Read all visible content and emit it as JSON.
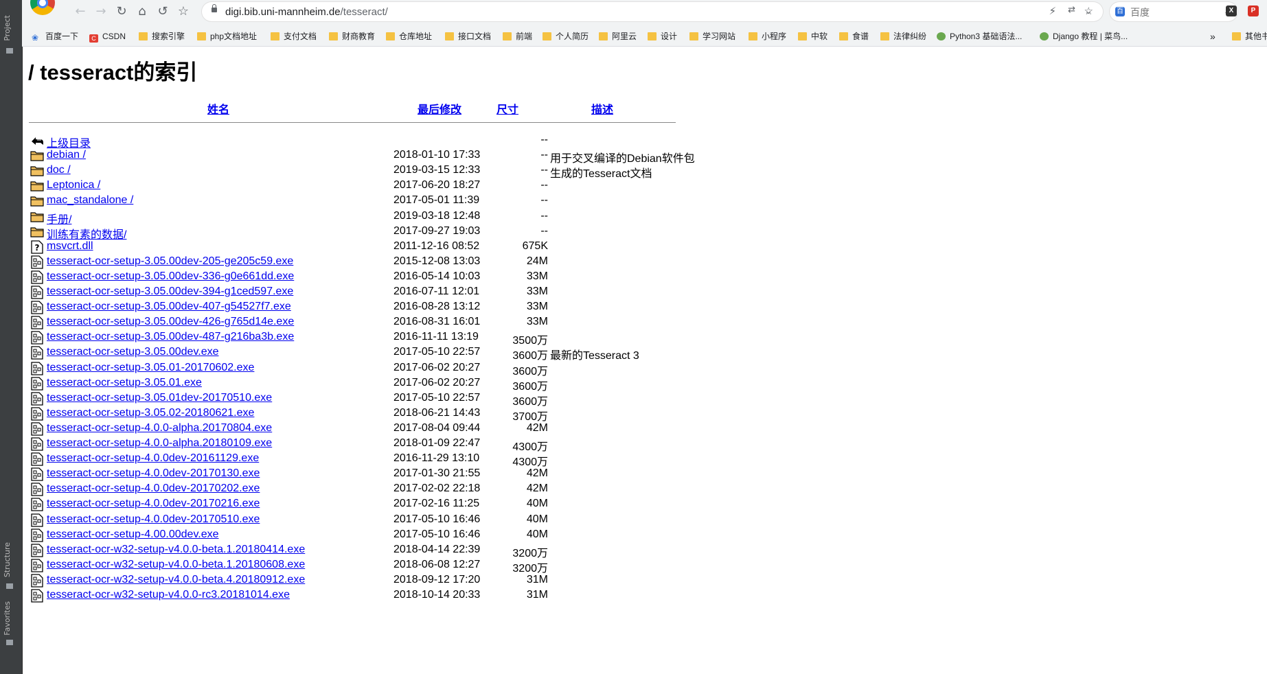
{
  "ide": {
    "tabs": [
      "Project",
      "Structure",
      "Favorites"
    ]
  },
  "browser": {
    "url_host": "digi.bib.uni-mannheim.de",
    "url_path": "/tesseract/",
    "search_placeholder": "百度",
    "bookmarks": [
      {
        "label": "百度一下",
        "icon": "paw-icon"
      },
      {
        "label": "CSDN",
        "icon": "csdn-icon"
      },
      {
        "label": "搜索引擎",
        "icon": "folder-icon"
      },
      {
        "label": "php文档地址",
        "icon": "folder-icon"
      },
      {
        "label": "支付文档",
        "icon": "folder-icon"
      },
      {
        "label": "财商教育",
        "icon": "folder-icon"
      },
      {
        "label": "仓库地址",
        "icon": "folder-icon"
      },
      {
        "label": "接口文档",
        "icon": "folder-icon"
      },
      {
        "label": "前端",
        "icon": "folder-icon"
      },
      {
        "label": "个人简历",
        "icon": "folder-icon"
      },
      {
        "label": "阿里云",
        "icon": "folder-icon"
      },
      {
        "label": "设计",
        "icon": "folder-icon"
      },
      {
        "label": "学习网站",
        "icon": "folder-icon"
      },
      {
        "label": "小程序",
        "icon": "folder-icon"
      },
      {
        "label": "中软",
        "icon": "folder-icon"
      },
      {
        "label": "食谱",
        "icon": "folder-icon"
      },
      {
        "label": "法律纠纷",
        "icon": "folder-icon"
      },
      {
        "label": "Python3 基础语法...",
        "icon": "runoob-icon"
      },
      {
        "label": "Django 教程 | 菜鸟...",
        "icon": "runoob-icon"
      }
    ],
    "more_bookmarks": "»",
    "other_bookmarks": "其他书"
  },
  "page": {
    "title": "/ tesseract的索引",
    "headers": {
      "name": "姓名",
      "modified": "最后修改",
      "size": "尺寸",
      "description": "描述"
    },
    "rows": [
      {
        "type": "back",
        "name": "上级目录",
        "date": "",
        "size": "--",
        "desc": ""
      },
      {
        "type": "folder",
        "name": "debian /",
        "date": "2018-01-10 17:33",
        "size": "--",
        "desc": "用于交叉编译的Debian软件包"
      },
      {
        "type": "folder",
        "name": "doc /",
        "date": "2019-03-15 12:33",
        "size": "--",
        "desc": "生成的Tesseract文档"
      },
      {
        "type": "folder",
        "name": "Leptonica /",
        "date": "2017-06-20 18:27",
        "size": "--",
        "desc": ""
      },
      {
        "type": "folder",
        "name": "mac_standalone /",
        "date": "2017-05-01 11:39",
        "size": "--",
        "desc": ""
      },
      {
        "type": "folder",
        "name": "手册/",
        "date": "2019-03-18 12:48",
        "size": "--",
        "desc": ""
      },
      {
        "type": "folder",
        "name": "训练有素的数据/",
        "date": "2017-09-27 19:03",
        "size": "--",
        "desc": ""
      },
      {
        "type": "unknown",
        "name": "msvcrt.dll",
        "date": "2011-12-16 08:52",
        "size": "675K",
        "desc": ""
      },
      {
        "type": "binary",
        "name": "tesseract-ocr-setup-3.05.00dev-205-ge205c59.exe",
        "date": "2015-12-08 13:03",
        "size": "24M",
        "desc": ""
      },
      {
        "type": "binary",
        "name": "tesseract-ocr-setup-3.05.00dev-336-g0e661dd.exe",
        "date": "2016-05-14 10:03",
        "size": "33M",
        "desc": ""
      },
      {
        "type": "binary",
        "name": "tesseract-ocr-setup-3.05.00dev-394-g1ced597.exe",
        "date": "2016-07-11 12:01",
        "size": "33M",
        "desc": ""
      },
      {
        "type": "binary",
        "name": "tesseract-ocr-setup-3.05.00dev-407-g54527f7.exe",
        "date": "2016-08-28 13:12",
        "size": "33M",
        "desc": ""
      },
      {
        "type": "binary",
        "name": "tesseract-ocr-setup-3.05.00dev-426-g765d14e.exe",
        "date": "2016-08-31 16:01",
        "size": "33M",
        "desc": ""
      },
      {
        "type": "binary",
        "name": "tesseract-ocr-setup-3.05.00dev-487-g216ba3b.exe",
        "date": "2016-11-11 13:19",
        "size": "3500万",
        "desc": ""
      },
      {
        "type": "binary",
        "name": "tesseract-ocr-setup-3.05.00dev.exe",
        "date": "2017-05-10 22:57",
        "size": "3600万",
        "desc": "最新的Tesseract 3"
      },
      {
        "type": "binary",
        "name": "tesseract-ocr-setup-3.05.01-20170602.exe",
        "date": "2017-06-02 20:27",
        "size": "3600万",
        "desc": ""
      },
      {
        "type": "binary",
        "name": "tesseract-ocr-setup-3.05.01.exe",
        "date": "2017-06-02 20:27",
        "size": "3600万",
        "desc": ""
      },
      {
        "type": "binary",
        "name": "tesseract-ocr-setup-3.05.01dev-20170510.exe",
        "date": "2017-05-10 22:57",
        "size": "3600万",
        "desc": ""
      },
      {
        "type": "binary",
        "name": "tesseract-ocr-setup-3.05.02-20180621.exe",
        "date": "2018-06-21 14:43",
        "size": "3700万",
        "desc": ""
      },
      {
        "type": "binary",
        "name": "tesseract-ocr-setup-4.0.0-alpha.20170804.exe",
        "date": "2017-08-04 09:44",
        "size": "42M",
        "desc": ""
      },
      {
        "type": "binary",
        "name": "tesseract-ocr-setup-4.0.0-alpha.20180109.exe",
        "date": "2018-01-09 22:47",
        "size": "4300万",
        "desc": ""
      },
      {
        "type": "binary",
        "name": "tesseract-ocr-setup-4.0.0dev-20161129.exe",
        "date": "2016-11-29 13:10",
        "size": "4300万",
        "desc": ""
      },
      {
        "type": "binary",
        "name": "tesseract-ocr-setup-4.0.0dev-20170130.exe",
        "date": "2017-01-30 21:55",
        "size": "42M",
        "desc": ""
      },
      {
        "type": "binary",
        "name": "tesseract-ocr-setup-4.0.0dev-20170202.exe",
        "date": "2017-02-02 22:18",
        "size": "42M",
        "desc": ""
      },
      {
        "type": "binary",
        "name": "tesseract-ocr-setup-4.0.0dev-20170216.exe",
        "date": "2017-02-16 11:25",
        "size": "40M",
        "desc": ""
      },
      {
        "type": "binary",
        "name": "tesseract-ocr-setup-4.0.0dev-20170510.exe",
        "date": "2017-05-10 16:46",
        "size": "40M",
        "desc": ""
      },
      {
        "type": "binary",
        "name": "tesseract-ocr-setup-4.00.00dev.exe",
        "date": "2017-05-10 16:46",
        "size": "40M",
        "desc": ""
      },
      {
        "type": "binary",
        "name": "tesseract-ocr-w32-setup-v4.0.0-beta.1.20180414.exe",
        "date": "2018-04-14 22:39",
        "size": "3200万",
        "desc": ""
      },
      {
        "type": "binary",
        "name": "tesseract-ocr-w32-setup-v4.0.0-beta.1.20180608.exe",
        "date": "2018-06-08 12:27",
        "size": "3200万",
        "desc": ""
      },
      {
        "type": "binary",
        "name": "tesseract-ocr-w32-setup-v4.0.0-beta.4.20180912.exe",
        "date": "2018-09-12 17:20",
        "size": "31M",
        "desc": ""
      },
      {
        "type": "binary",
        "name": "tesseract-ocr-w32-setup-v4.0.0-rc3.20181014.exe",
        "date": "2018-10-14 20:33",
        "size": "31M",
        "desc": ""
      }
    ]
  }
}
